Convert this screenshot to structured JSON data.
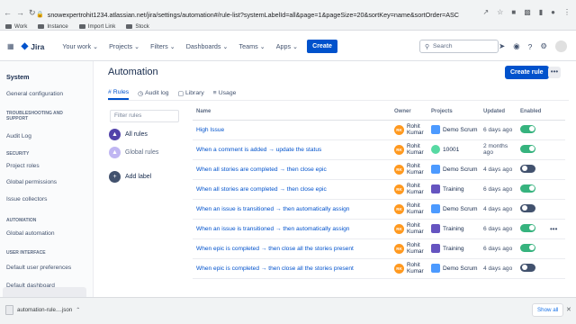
{
  "browser": {
    "url": "snowexpertrohit1234.atlassian.net/jira/settings/automation#/rule-list?systemLabelId=all&page=1&pageSize=20&sortKey=name&sortOrder=ASC",
    "bookmarks": [
      "Work",
      "Instance",
      "Import Link",
      "Stock"
    ]
  },
  "topnav": {
    "product": "Jira",
    "items": [
      "Your work",
      "Projects",
      "Filters",
      "Dashboards",
      "Teams",
      "Apps"
    ],
    "create_label": "Create",
    "search_placeholder": "Search"
  },
  "sidebar": {
    "title": "System",
    "items": [
      {
        "type": "item",
        "label": "General configuration"
      },
      {
        "type": "section",
        "label": "TROUBLESHOOTING AND SUPPORT"
      },
      {
        "type": "item",
        "label": "Audit Log"
      },
      {
        "type": "section",
        "label": "SECURITY"
      },
      {
        "type": "item",
        "label": "Project roles"
      },
      {
        "type": "item",
        "label": "Global permissions"
      },
      {
        "type": "item",
        "label": "Issue collectors"
      },
      {
        "type": "section",
        "label": "AUTOMATION"
      },
      {
        "type": "item",
        "label": "Global automation",
        "active": true
      },
      {
        "type": "section",
        "label": "USER INTERFACE"
      },
      {
        "type": "item",
        "label": "Default user preferences"
      },
      {
        "type": "item",
        "label": "Default dashboard"
      }
    ]
  },
  "main": {
    "title": "Automation",
    "create_rule_label": "Create rule",
    "more_label": "•••",
    "tabs": [
      {
        "label": "Rules",
        "icon": "rules-icon",
        "active": true
      },
      {
        "label": "Audit log",
        "icon": "audit-log-icon"
      },
      {
        "label": "Library",
        "icon": "library-icon"
      },
      {
        "label": "Usage",
        "icon": "usage-icon"
      }
    ],
    "filter_placeholder": "Filter rules",
    "label_filters": [
      "All rules",
      "Global rules"
    ],
    "add_label": "Add label"
  },
  "table": {
    "columns": [
      "Name",
      "Owner",
      "Projects",
      "Updated",
      "Enabled"
    ],
    "rows": [
      {
        "name": "High Issue",
        "owner": [
          "Rohit",
          "Kumar"
        ],
        "initials": "RK",
        "project": "Demo Scrum",
        "project_icon": "scrum",
        "updated": [
          "6 days ago"
        ],
        "enabled": true
      },
      {
        "name": "When a comment is added → update the status",
        "owner": [
          "Rohit",
          "Kumar"
        ],
        "initials": "RK",
        "project": "10001",
        "project_icon": "global",
        "updated": [
          "2 months",
          "ago"
        ],
        "enabled": true
      },
      {
        "name": "When all stories are completed → then close epic",
        "owner": [
          "Rohit",
          "Kumar"
        ],
        "initials": "RK",
        "project": "Demo Scrum",
        "project_icon": "scrum",
        "updated": [
          "4 days ago"
        ],
        "enabled": false
      },
      {
        "name": "When all stories are completed → then close epic",
        "owner": [
          "Rohit",
          "Kumar"
        ],
        "initials": "RK",
        "project": "Training",
        "project_icon": "training",
        "updated": [
          "6 days ago"
        ],
        "enabled": true
      },
      {
        "name": "When an issue is transitioned → then automatically assign",
        "owner": [
          "Rohit",
          "Kumar"
        ],
        "initials": "RK",
        "project": "Demo Scrum",
        "project_icon": "scrum",
        "updated": [
          "4 days ago"
        ],
        "enabled": false
      },
      {
        "name": "When an issue is transitioned → then automatically assign",
        "owner": [
          "Rohit",
          "Kumar"
        ],
        "initials": "RK",
        "project": "Training",
        "project_icon": "training",
        "updated": [
          "6 days ago"
        ],
        "enabled": true
      },
      {
        "name": "When epic is completed → then close all the stories present",
        "owner": [
          "Rohit",
          "Kumar"
        ],
        "initials": "RK",
        "project": "Training",
        "project_icon": "training",
        "updated": [
          "6 days ago"
        ],
        "enabled": true
      },
      {
        "name": "When epic is completed → then close all the stories present",
        "owner": [
          "Rohit",
          "Kumar"
        ],
        "initials": "RK",
        "project": "Demo Scrum",
        "project_icon": "scrum",
        "updated": [
          "4 days ago"
        ],
        "enabled": false
      }
    ]
  },
  "downloads": {
    "file": "automation-rule....json",
    "show_all": "Show all"
  }
}
